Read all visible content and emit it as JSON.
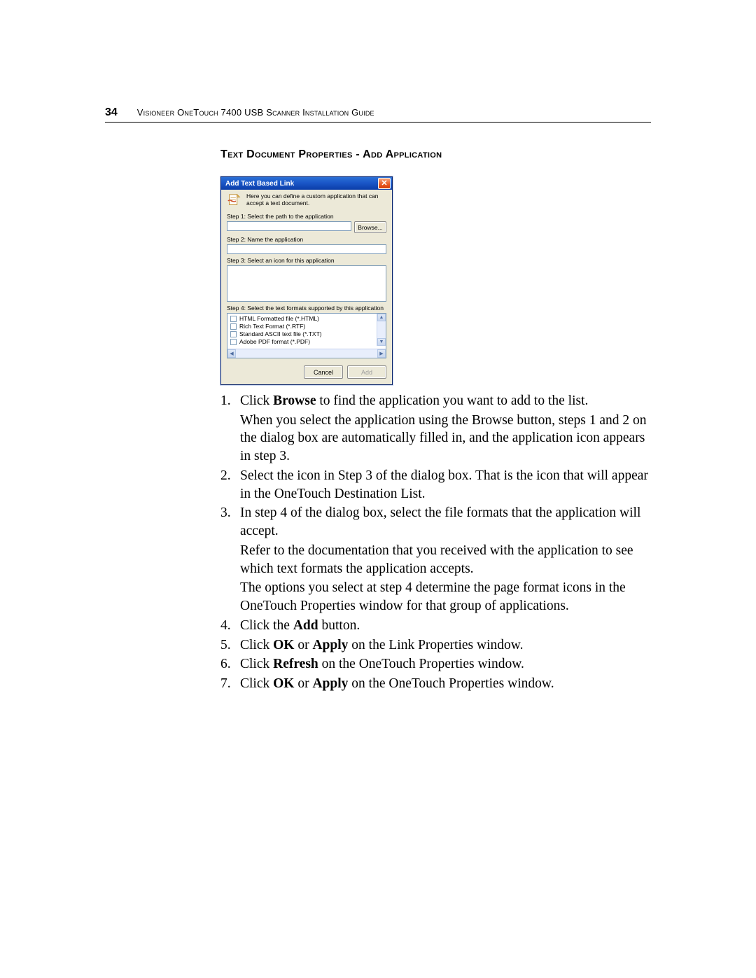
{
  "page_number": "34",
  "header_text": "Visioneer OneTouch 7400 USB Scanner Installation Guide",
  "section_title": "Text Document Properties - Add Application",
  "dialog": {
    "title": "Add Text Based Link",
    "close_glyph": "✕",
    "intro": "Here you can define a custom application that can accept a text document.",
    "step1_label": "Step 1: Select the path to the application",
    "browse_label": "Browse...",
    "step2_label": "Step 2: Name the application",
    "step3_label": "Step 3: Select an icon for this application",
    "step4_label": "Step 4: Select the text formats supported by this application",
    "formats": [
      "HTML Formatted file (*.HTML)",
      "Rich Text Format (*.RTF)",
      "Standard ASCII text file (*.TXT)",
      "Adobe PDF format (*.PDF)"
    ],
    "cancel_label": "Cancel",
    "add_label": "Add"
  },
  "instructions": {
    "items": [
      {
        "num": "1",
        "main_pre": "Click ",
        "main_bold": "Browse",
        "main_post": " to find the application you want to add to the list.",
        "extra": [
          "When you select the application using the Browse button, steps 1 and 2 on the dialog box are automatically filled in, and the application icon appears in step 3."
        ]
      },
      {
        "num": "2",
        "main_pre": "Select the icon in Step 3 of the dialog box. That is the icon that will appear in the OneTouch Destination List.",
        "main_bold": "",
        "main_post": "",
        "extra": []
      },
      {
        "num": "3",
        "main_pre": "In step 4 of the dialog box, select the file formats that the application will accept.",
        "main_bold": "",
        "main_post": "",
        "extra": [
          "Refer to the documentation that you received with the application to see which text formats the application accepts.",
          "The options you select at step 4 determine the page format icons in the OneTouch Properties window for that group of applications."
        ]
      },
      {
        "num": "4",
        "main_pre": "Click the ",
        "main_bold": "Add",
        "main_post": " button.",
        "extra": []
      },
      {
        "num": "5",
        "main_pre": "Click ",
        "main_bold": "OK",
        "main_mid": " or ",
        "main_bold2": "Apply",
        "main_post": " on the Link Properties window.",
        "extra": []
      },
      {
        "num": "6",
        "main_pre": "Click ",
        "main_bold": "Refresh",
        "main_post": " on the OneTouch Properties window.",
        "extra": []
      },
      {
        "num": "7",
        "main_pre": "Click ",
        "main_bold": "OK",
        "main_mid": " or ",
        "main_bold2": "Apply",
        "main_post": " on the OneTouch Properties window.",
        "extra": []
      }
    ]
  }
}
